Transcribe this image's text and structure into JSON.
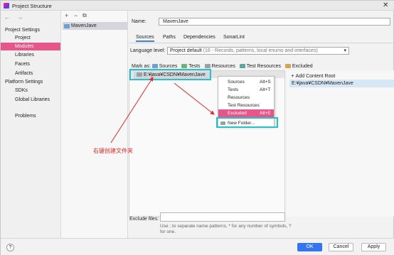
{
  "window": {
    "title": "Project Structure",
    "close_glyph": "✕"
  },
  "nav": {
    "back_forward": "← →",
    "project_settings": "Project Settings",
    "project_items": [
      "Project",
      "Modules",
      "Libraries",
      "Facets",
      "Artifacts"
    ],
    "platform_settings": "Platform Settings",
    "platform_items": [
      "SDKs",
      "Global Libraries"
    ],
    "problems": "Problems"
  },
  "modules": {
    "add": "+",
    "remove": "−",
    "copy": "⧉",
    "items": [
      "MavenJave"
    ]
  },
  "main": {
    "name_label": "Name:",
    "name_value": "MavenJave",
    "tabs": [
      "Sources",
      "Paths",
      "Dependencies",
      "SonarLint"
    ],
    "language_level_label": "Language level:",
    "language_level_value": "Project default",
    "language_level_detail": "(16 - Records, patterns, local enums and interfaces)",
    "mark_as_label": "Mark as:",
    "mark_as": [
      "Sources",
      "Tests",
      "Resources",
      "Test Resources",
      "Excluded"
    ],
    "tree_root": "E:¥java¥CSDN¥MavenJave",
    "add_content_root": "Add Content Root",
    "content_root": "E:¥java¥CSDN¥MavenJave",
    "exclude_files_label": "Exclude files:",
    "exclude_hint": "Use ; to separate name patterns, * for any number of symbols, ? for one."
  },
  "context_menu": {
    "items": [
      {
        "label": "Sources",
        "shortcut": "Alt+S"
      },
      {
        "label": "Tests",
        "shortcut": "Alt+T"
      },
      {
        "label": "Resources",
        "shortcut": ""
      },
      {
        "label": "Test Resources",
        "shortcut": ""
      },
      {
        "label": "Excluded",
        "shortcut": "Alt+E"
      }
    ],
    "new_folder": "New Folder..."
  },
  "annotation": "右键创建文件夹",
  "buttons": {
    "help": "?",
    "ok": "OK",
    "cancel": "Cancel",
    "apply": "Apply"
  },
  "colors": {
    "selection": "#e65689",
    "highlight_box": "#22c3cf",
    "arrow": "#e02b25",
    "primary_button": "#3574f0"
  },
  "icons": [
    "back-arrow-icon",
    "forward-arrow-icon",
    "folder-icon",
    "help-icon",
    "close-icon",
    "chevron-down-icon",
    "plus-icon",
    "new-folder-icon"
  ]
}
